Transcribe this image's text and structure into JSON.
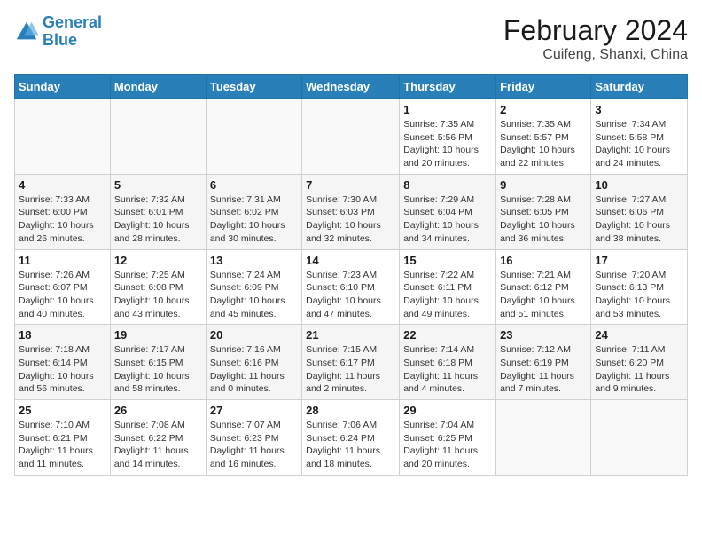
{
  "logo": {
    "line1": "General",
    "line2": "Blue"
  },
  "title": "February 2024",
  "subtitle": "Cuifeng, Shanxi, China",
  "weekdays": [
    "Sunday",
    "Monday",
    "Tuesday",
    "Wednesday",
    "Thursday",
    "Friday",
    "Saturday"
  ],
  "weeks": [
    [
      {
        "day": "",
        "info": ""
      },
      {
        "day": "",
        "info": ""
      },
      {
        "day": "",
        "info": ""
      },
      {
        "day": "",
        "info": ""
      },
      {
        "day": "1",
        "info": "Sunrise: 7:35 AM\nSunset: 5:56 PM\nDaylight: 10 hours and 20 minutes."
      },
      {
        "day": "2",
        "info": "Sunrise: 7:35 AM\nSunset: 5:57 PM\nDaylight: 10 hours and 22 minutes."
      },
      {
        "day": "3",
        "info": "Sunrise: 7:34 AM\nSunset: 5:58 PM\nDaylight: 10 hours and 24 minutes."
      }
    ],
    [
      {
        "day": "4",
        "info": "Sunrise: 7:33 AM\nSunset: 6:00 PM\nDaylight: 10 hours and 26 minutes."
      },
      {
        "day": "5",
        "info": "Sunrise: 7:32 AM\nSunset: 6:01 PM\nDaylight: 10 hours and 28 minutes."
      },
      {
        "day": "6",
        "info": "Sunrise: 7:31 AM\nSunset: 6:02 PM\nDaylight: 10 hours and 30 minutes."
      },
      {
        "day": "7",
        "info": "Sunrise: 7:30 AM\nSunset: 6:03 PM\nDaylight: 10 hours and 32 minutes."
      },
      {
        "day": "8",
        "info": "Sunrise: 7:29 AM\nSunset: 6:04 PM\nDaylight: 10 hours and 34 minutes."
      },
      {
        "day": "9",
        "info": "Sunrise: 7:28 AM\nSunset: 6:05 PM\nDaylight: 10 hours and 36 minutes."
      },
      {
        "day": "10",
        "info": "Sunrise: 7:27 AM\nSunset: 6:06 PM\nDaylight: 10 hours and 38 minutes."
      }
    ],
    [
      {
        "day": "11",
        "info": "Sunrise: 7:26 AM\nSunset: 6:07 PM\nDaylight: 10 hours and 40 minutes."
      },
      {
        "day": "12",
        "info": "Sunrise: 7:25 AM\nSunset: 6:08 PM\nDaylight: 10 hours and 43 minutes."
      },
      {
        "day": "13",
        "info": "Sunrise: 7:24 AM\nSunset: 6:09 PM\nDaylight: 10 hours and 45 minutes."
      },
      {
        "day": "14",
        "info": "Sunrise: 7:23 AM\nSunset: 6:10 PM\nDaylight: 10 hours and 47 minutes."
      },
      {
        "day": "15",
        "info": "Sunrise: 7:22 AM\nSunset: 6:11 PM\nDaylight: 10 hours and 49 minutes."
      },
      {
        "day": "16",
        "info": "Sunrise: 7:21 AM\nSunset: 6:12 PM\nDaylight: 10 hours and 51 minutes."
      },
      {
        "day": "17",
        "info": "Sunrise: 7:20 AM\nSunset: 6:13 PM\nDaylight: 10 hours and 53 minutes."
      }
    ],
    [
      {
        "day": "18",
        "info": "Sunrise: 7:18 AM\nSunset: 6:14 PM\nDaylight: 10 hours and 56 minutes."
      },
      {
        "day": "19",
        "info": "Sunrise: 7:17 AM\nSunset: 6:15 PM\nDaylight: 10 hours and 58 minutes."
      },
      {
        "day": "20",
        "info": "Sunrise: 7:16 AM\nSunset: 6:16 PM\nDaylight: 11 hours and 0 minutes."
      },
      {
        "day": "21",
        "info": "Sunrise: 7:15 AM\nSunset: 6:17 PM\nDaylight: 11 hours and 2 minutes."
      },
      {
        "day": "22",
        "info": "Sunrise: 7:14 AM\nSunset: 6:18 PM\nDaylight: 11 hours and 4 minutes."
      },
      {
        "day": "23",
        "info": "Sunrise: 7:12 AM\nSunset: 6:19 PM\nDaylight: 11 hours and 7 minutes."
      },
      {
        "day": "24",
        "info": "Sunrise: 7:11 AM\nSunset: 6:20 PM\nDaylight: 11 hours and 9 minutes."
      }
    ],
    [
      {
        "day": "25",
        "info": "Sunrise: 7:10 AM\nSunset: 6:21 PM\nDaylight: 11 hours and 11 minutes."
      },
      {
        "day": "26",
        "info": "Sunrise: 7:08 AM\nSunset: 6:22 PM\nDaylight: 11 hours and 14 minutes."
      },
      {
        "day": "27",
        "info": "Sunrise: 7:07 AM\nSunset: 6:23 PM\nDaylight: 11 hours and 16 minutes."
      },
      {
        "day": "28",
        "info": "Sunrise: 7:06 AM\nSunset: 6:24 PM\nDaylight: 11 hours and 18 minutes."
      },
      {
        "day": "29",
        "info": "Sunrise: 7:04 AM\nSunset: 6:25 PM\nDaylight: 11 hours and 20 minutes."
      },
      {
        "day": "",
        "info": ""
      },
      {
        "day": "",
        "info": ""
      }
    ]
  ]
}
